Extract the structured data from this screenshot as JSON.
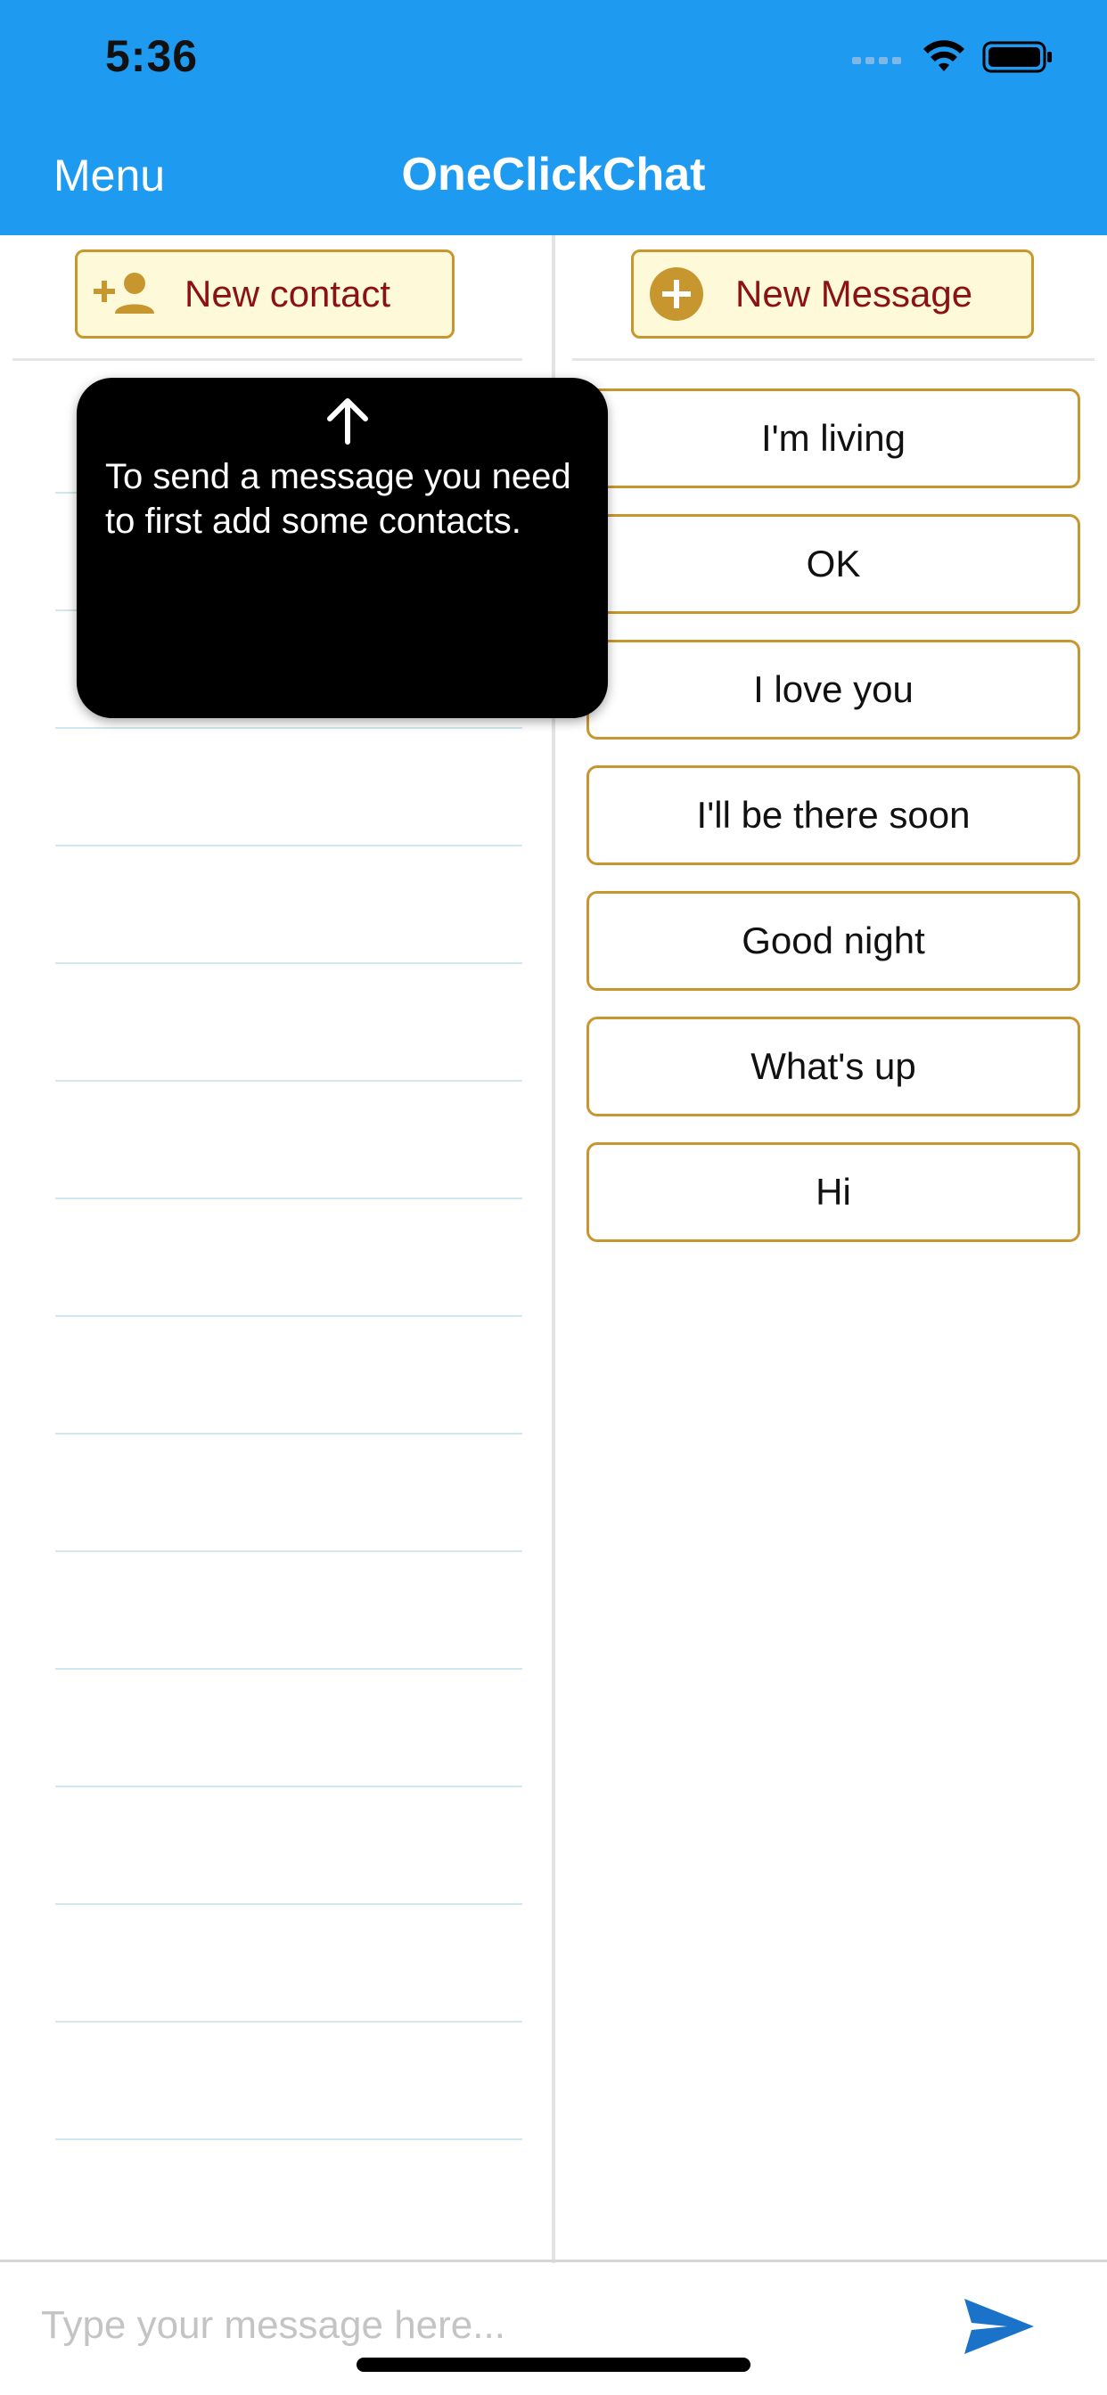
{
  "status_bar": {
    "time": "5:36"
  },
  "header": {
    "menu_label": "Menu",
    "title": "OneClickChat"
  },
  "left_panel": {
    "new_contact_label": "New contact"
  },
  "right_panel": {
    "new_message_label": "New Message",
    "messages": [
      "I'm living",
      "OK",
      "I love you",
      "I'll be there soon",
      "Good night",
      "What's up",
      "Hi"
    ]
  },
  "tooltip": {
    "text": "To send a message you need to first add some contacts."
  },
  "composer": {
    "placeholder": "Type your message here..."
  },
  "colors": {
    "header_bg": "#1e9bf0",
    "button_border": "#c8962f",
    "button_bg": "#fefad9",
    "button_text": "#8b1212",
    "send_icon": "#1a73c8"
  }
}
